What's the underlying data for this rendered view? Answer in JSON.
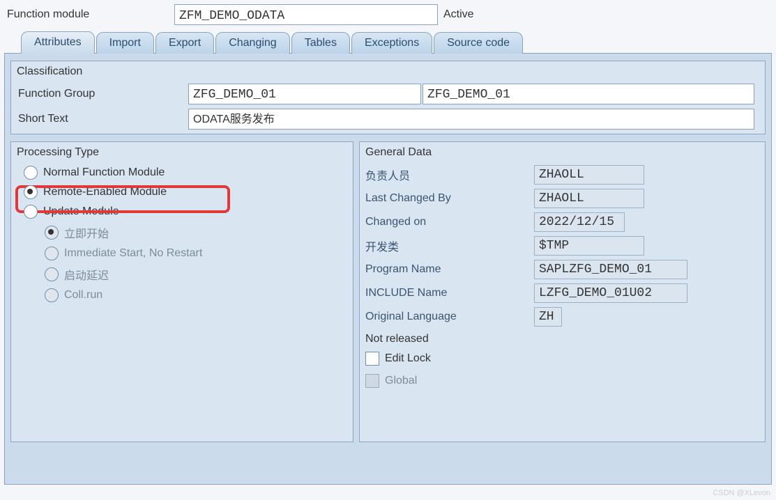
{
  "header": {
    "label": "Function module",
    "value": "ZFM_DEMO_ODATA",
    "status": "Active"
  },
  "tabs": [
    {
      "label": "Attributes",
      "active": true
    },
    {
      "label": "Import"
    },
    {
      "label": "Export"
    },
    {
      "label": "Changing"
    },
    {
      "label": "Tables"
    },
    {
      "label": "Exceptions"
    },
    {
      "label": "Source code"
    }
  ],
  "classification": {
    "title": "Classification",
    "function_group_label": "Function Group",
    "function_group": "ZFG_DEMO_01",
    "function_group_desc": "ZFG_DEMO_01",
    "short_text_label": "Short Text",
    "short_text": "ODATA服务发布"
  },
  "processing_type": {
    "title": "Processing Type",
    "options": {
      "normal": "Normal Function Module",
      "remote": "Remote-Enabled Module",
      "update": "Update Module"
    },
    "update_sub": {
      "immediate": "立即开始",
      "no_restart": "Immediate Start, No Restart",
      "delayed": "启动延迟",
      "coll_run": "Coll.run"
    }
  },
  "general_data": {
    "title": "General Data",
    "rows": {
      "person_label": "负责人员",
      "person_value": "ZHAOLL",
      "last_changed_by_label": "Last Changed By",
      "last_changed_by_value": "ZHAOLL",
      "changed_on_label": "Changed on",
      "changed_on_value": "2022/12/15",
      "dev_class_label": "开发类",
      "dev_class_value": "$TMP",
      "program_name_label": "Program Name",
      "program_name_value": "SAPLZFG_DEMO_01",
      "include_name_label": "INCLUDE Name",
      "include_name_value": "LZFG_DEMO_01U02",
      "orig_lang_label": "Original Language",
      "orig_lang_value": "ZH"
    },
    "not_released": "Not released",
    "edit_lock": "Edit Lock",
    "global": "Global"
  },
  "watermark": "CSDN @XLevon"
}
